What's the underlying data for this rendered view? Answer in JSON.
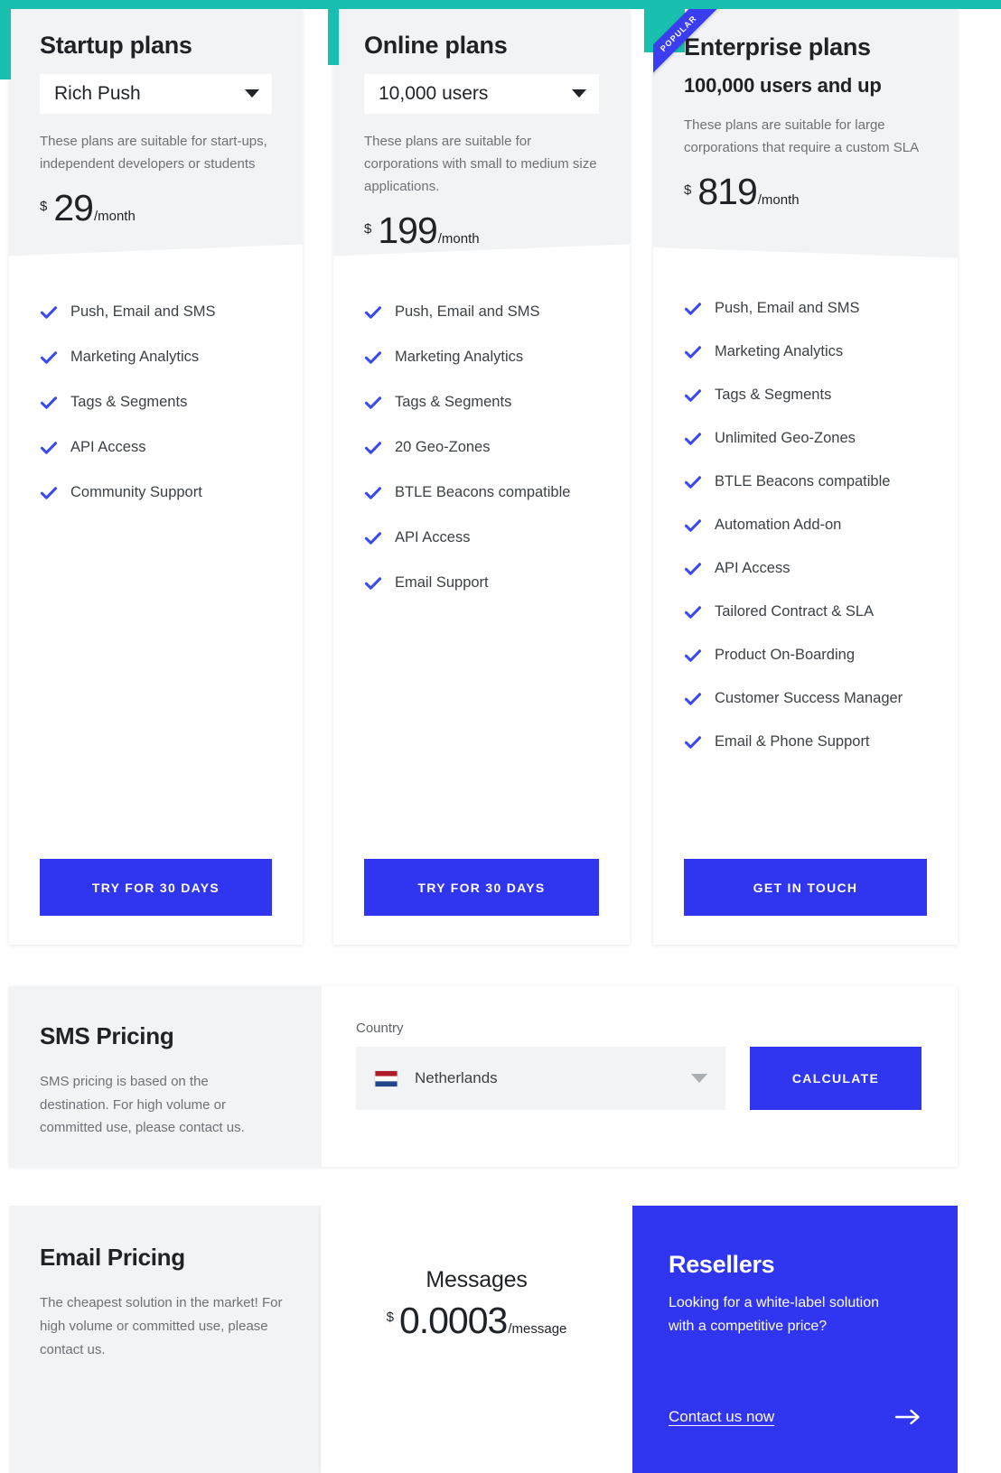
{
  "theme": {
    "accent_teal": "#19bfae",
    "brand_blue": "#3035ef",
    "ribbon_blue": "#3b3ef0",
    "panel_grey": "#f1f3f4",
    "text_dark": "#1f2327",
    "text_muted": "#6c7278"
  },
  "plans": [
    {
      "title": "Startup plans",
      "selected_option": "Rich Push",
      "description": "These plans are suitable for start-ups, independent developers or students",
      "currency": "$",
      "amount": "29",
      "period": "/month",
      "features": [
        "Push, Email and SMS",
        "Marketing Analytics",
        "Tags & Segments",
        "API Access",
        "Community Support"
      ],
      "cta": "TRY FOR 30 DAYS"
    },
    {
      "title": "Online plans",
      "selected_option": "10,000 users",
      "description": "These plans are suitable for corporations with small to medium size applications.",
      "currency": "$",
      "amount": "199",
      "period": "/month",
      "features": [
        "Push, Email and SMS",
        "Marketing Analytics",
        "Tags & Segments",
        "20 Geo-Zones",
        "BTLE Beacons compatible",
        "API Access",
        "Email Support"
      ],
      "cta": "TRY FOR 30 DAYS"
    },
    {
      "title": "Enterprise plans",
      "badge": "POPULAR",
      "users_line": "100,000 users and up",
      "description": "These plans are suitable for large corporations that require a custom SLA",
      "currency": "$",
      "amount": "819",
      "period": "/month",
      "features": [
        "Push, Email and SMS",
        "Marketing Analytics",
        "Tags & Segments",
        "Unlimited Geo-Zones",
        "BTLE Beacons compatible",
        "Automation Add-on",
        "API Access",
        "Tailored Contract & SLA",
        "Product On-Boarding",
        "Customer Success Manager",
        "Email & Phone Support"
      ],
      "cta": "GET IN TOUCH"
    }
  ],
  "sms": {
    "title": "SMS Pricing",
    "note": "SMS pricing is based on the destination. For high volume or committed use, please contact us.",
    "country_label": "Country",
    "country_value": "Netherlands",
    "calculate_label": "CALCULATE"
  },
  "email": {
    "title": "Email Pricing",
    "note": "The cheapest solution in the market! For high volume or committed use, please contact us.",
    "messages_label": "Messages",
    "currency": "$",
    "amount": "0.0003",
    "period": "/message"
  },
  "resellers": {
    "title": "Resellers",
    "subtitle": "Looking for a white-label solution with a competitive price?",
    "link_label": "Contact us now"
  }
}
